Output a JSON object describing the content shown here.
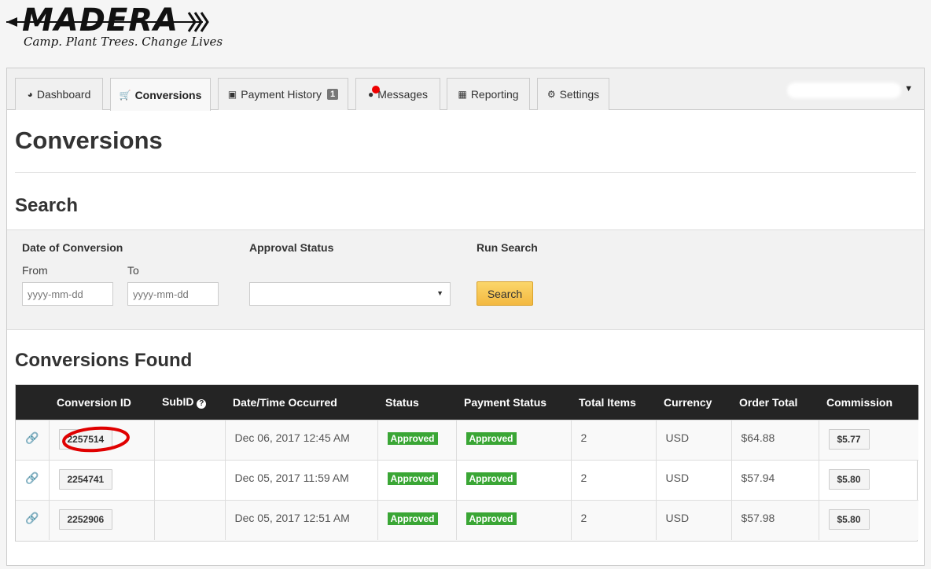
{
  "brand": {
    "name": "MADERA",
    "tagline": "Camp. Plant Trees. Change Lives"
  },
  "nav": {
    "tabs": [
      {
        "label": "Dashboard",
        "icon": "dashboard-icon"
      },
      {
        "label": "Conversions",
        "icon": "cart-icon",
        "active": true
      },
      {
        "label": "Payment History",
        "icon": "money-icon",
        "badge": "1"
      },
      {
        "label": "Messages",
        "icon": "comment-icon",
        "notification": true
      },
      {
        "label": "Reporting",
        "icon": "chart-icon"
      },
      {
        "label": "Settings",
        "icon": "gear-icon"
      }
    ]
  },
  "page": {
    "title": "Conversions",
    "search_heading": "Search",
    "results_heading": "Conversions Found"
  },
  "search": {
    "date_label": "Date of Conversion",
    "from_label": "From",
    "to_label": "To",
    "from_placeholder": "yyyy-mm-dd",
    "to_placeholder": "yyyy-mm-dd",
    "approval_label": "Approval Status",
    "run_label": "Run Search",
    "button_label": "Search"
  },
  "table": {
    "columns": [
      "",
      "Conversion ID",
      "SubID",
      "Date/Time Occurred",
      "Status",
      "Payment Status",
      "Total Items",
      "Currency",
      "Order Total",
      "Commission"
    ],
    "rows": [
      {
        "id": "2257514",
        "subid": "",
        "date": "Dec 06, 2017 12:45 AM",
        "status": "Approved",
        "payment": "Approved",
        "items": "2",
        "currency": "USD",
        "total": "$64.88",
        "commission": "$5.77"
      },
      {
        "id": "2254741",
        "subid": "",
        "date": "Dec 05, 2017 11:59 AM",
        "status": "Approved",
        "payment": "Approved",
        "items": "2",
        "currency": "USD",
        "total": "$57.94",
        "commission": "$5.80"
      },
      {
        "id": "2252906",
        "subid": "",
        "date": "Dec 05, 2017 12:51 AM",
        "status": "Approved",
        "payment": "Approved",
        "items": "2",
        "currency": "USD",
        "total": "$57.98",
        "commission": "$5.80"
      }
    ]
  },
  "colors": {
    "header_bg": "#242424",
    "approved_green": "#3aa635",
    "search_button": "#f3b941",
    "highlight_red": "#e00000"
  }
}
